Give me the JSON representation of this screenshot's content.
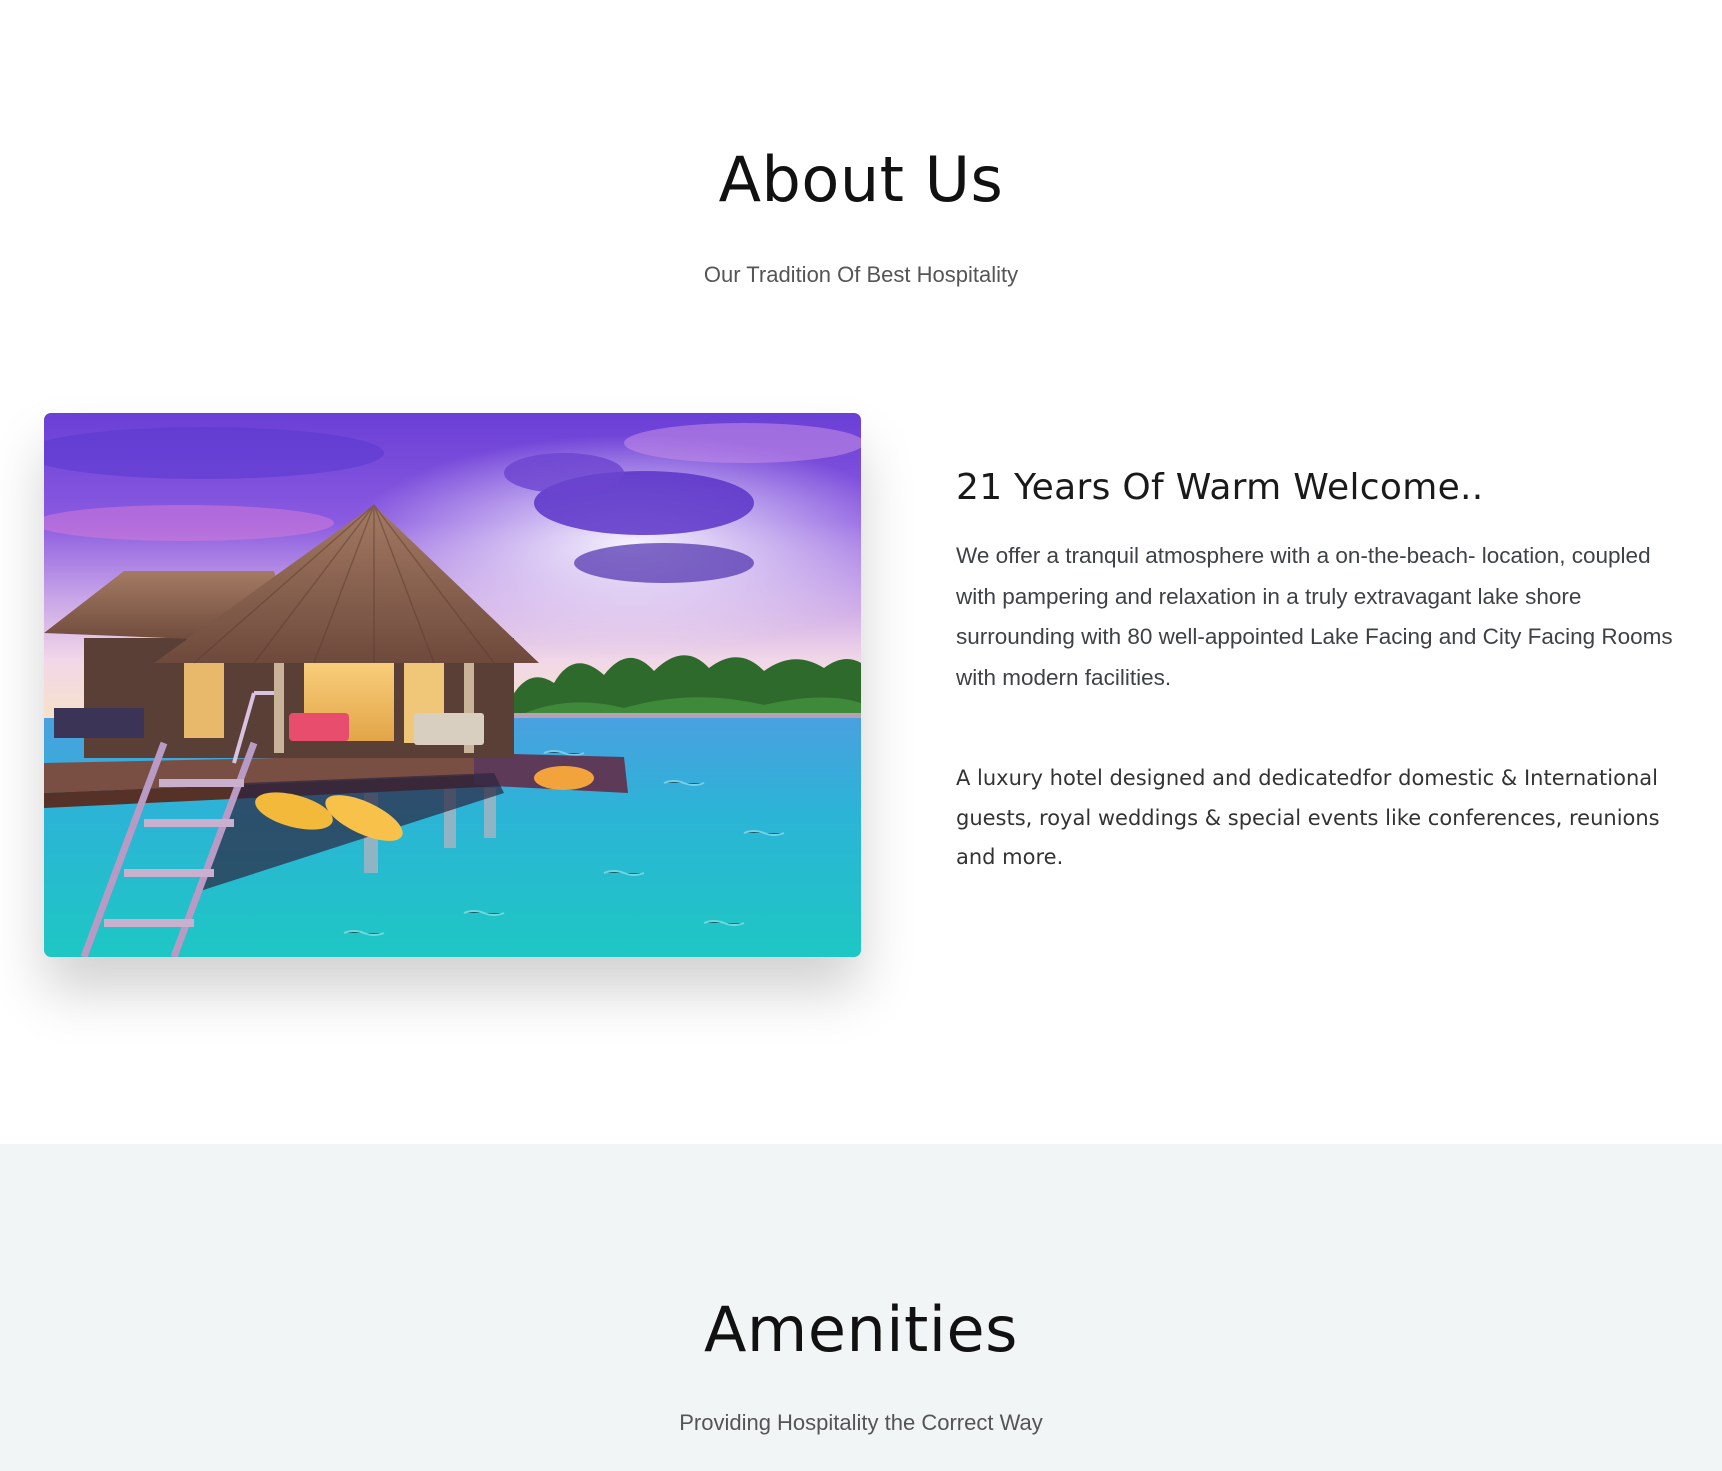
{
  "about": {
    "title": "About Us",
    "subtitle": "Our Tradition Of Best Hospitality",
    "image": {
      "description": "overwater-bungalow-photo"
    },
    "heading": "21 Years Of Warm Welcome..",
    "paragraph_1": "We offer a tranquil atmosphere with a on-the-beach- location, coupled with pampering and relaxation in a truly extravagant lake shore surrounding with 80 well-appointed Lake Facing and City Facing Rooms with modern facilities.",
    "paragraph_2": "A luxury hotel designed and dedicatedfor domestic & International guests, royal weddings & special events like conferences, reunions and more."
  },
  "amenities": {
    "title": "Amenities",
    "subtitle": "Providing Hospitality the Correct Way"
  },
  "colors": {
    "page_background": "#ffffff",
    "amenities_background": "#f2f5f6",
    "heading_text": "#111111",
    "subtitle_text": "#555555"
  }
}
